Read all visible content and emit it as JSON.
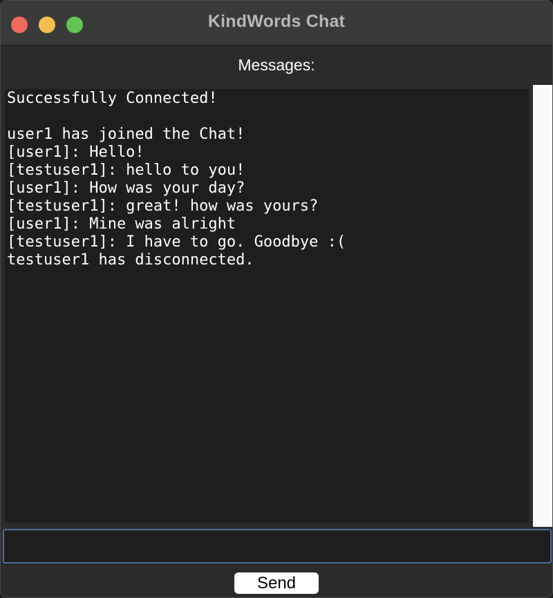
{
  "window": {
    "title": "KindWords Chat"
  },
  "messages_label": "Messages:",
  "chat_log": [
    "Successfully Connected!",
    "",
    "user1 has joined the Chat!",
    "[user1]: Hello!",
    "[testuser1]: hello to you!",
    "[user1]: How was your day?",
    "[testuser1]: great! how was yours?",
    "[user1]: Mine was alright",
    "[testuser1]: I have to go. Goodbye :(",
    "testuser1 has disconnected."
  ],
  "input": {
    "value": "",
    "placeholder": ""
  },
  "send_button": {
    "label": "Send"
  },
  "colors": {
    "close": "#ee6a5e",
    "minimize": "#f5bf4f",
    "maximize": "#61c454",
    "input_focus_border": "#4a6e9e"
  }
}
